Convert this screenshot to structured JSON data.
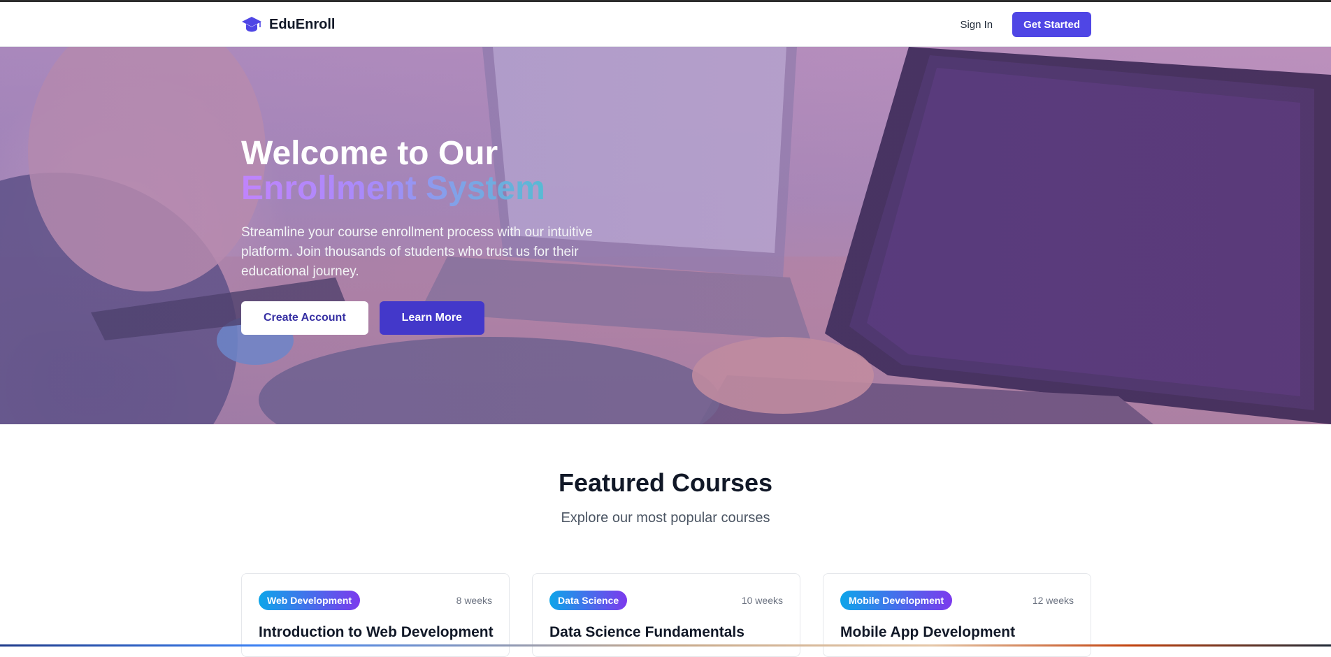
{
  "nav": {
    "brand": "EduEnroll",
    "sign_in": "Sign In",
    "get_started": "Get Started"
  },
  "hero": {
    "title_line1": "Welcome to Our",
    "title_line2": "Enrollment System",
    "subtitle": "Streamline your course enrollment process with our intuitive platform. Join thousands of students who trust us for their educational journey.",
    "primary_button": "Create Account",
    "secondary_button": "Learn More"
  },
  "featured": {
    "title": "Featured Courses",
    "subtitle": "Explore our most popular courses",
    "courses": [
      {
        "category": "Web Development",
        "duration": "8 weeks",
        "title": "Introduction to Web Development"
      },
      {
        "category": "Data Science",
        "duration": "10 weeks",
        "title": "Data Science Fundamentals"
      },
      {
        "category": "Mobile Development",
        "duration": "12 weeks",
        "title": "Mobile App Development"
      }
    ]
  },
  "colors": {
    "brand": "#4f46e5",
    "brand_dark": "#4338ca",
    "text": "#111827"
  },
  "icons": {
    "brand_icon": "graduation-cap-icon"
  }
}
